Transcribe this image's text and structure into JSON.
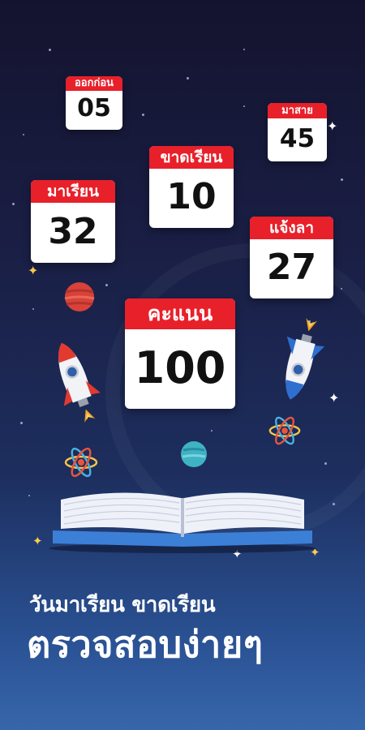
{
  "calendars": {
    "early": {
      "label": "ออกก่อน",
      "value": "05"
    },
    "late": {
      "label": "มาสาย",
      "value": "45"
    },
    "absent": {
      "label": "ขาดเรียน",
      "value": "10"
    },
    "present": {
      "label": "มาเรียน",
      "value": "32"
    },
    "leave": {
      "label": "แจ้งลา",
      "value": "27"
    },
    "score": {
      "label": "คะแนน",
      "value": "100"
    }
  },
  "caption": {
    "line1": "วันมาเรียน ขาดเรียน",
    "line2": "ตรวจสอบง่ายๆ"
  },
  "colors": {
    "calendar_header": "#e8202a",
    "background_top": "#14132f",
    "background_bottom": "#3766aa",
    "book_cover": "#3c7fd6"
  },
  "icons": [
    "rocket-icon",
    "planet-icon",
    "atom-icon",
    "open-book-icon",
    "star-icon"
  ]
}
